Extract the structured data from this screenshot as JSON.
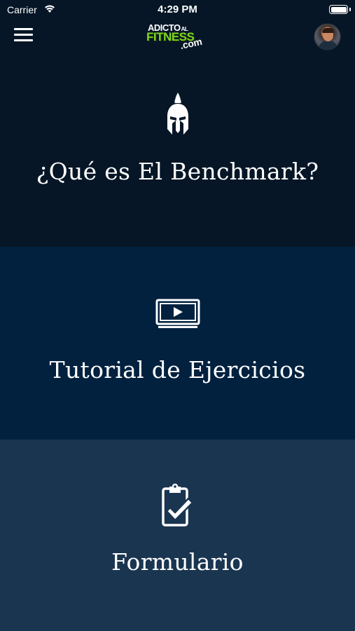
{
  "status_bar": {
    "carrier": "Carrier",
    "time": "4:29 PM"
  },
  "header": {
    "logo": {
      "line1": "ADICTO",
      "line1_small": "AL",
      "line2": "FITNESS",
      "line3": ".com"
    }
  },
  "sections": [
    {
      "label": "¿Qué es El Benchmark?",
      "icon": "spartan-helmet-icon"
    },
    {
      "label": "Tutorial de Ejercicios",
      "icon": "video-play-icon"
    },
    {
      "label": "Formulario",
      "icon": "clipboard-check-icon"
    }
  ],
  "colors": {
    "section1_bg": "#061626",
    "section2_bg": "#01213f",
    "section3_bg": "#1a3550",
    "logo_green": "#7ed321",
    "text": "#ffffff"
  }
}
